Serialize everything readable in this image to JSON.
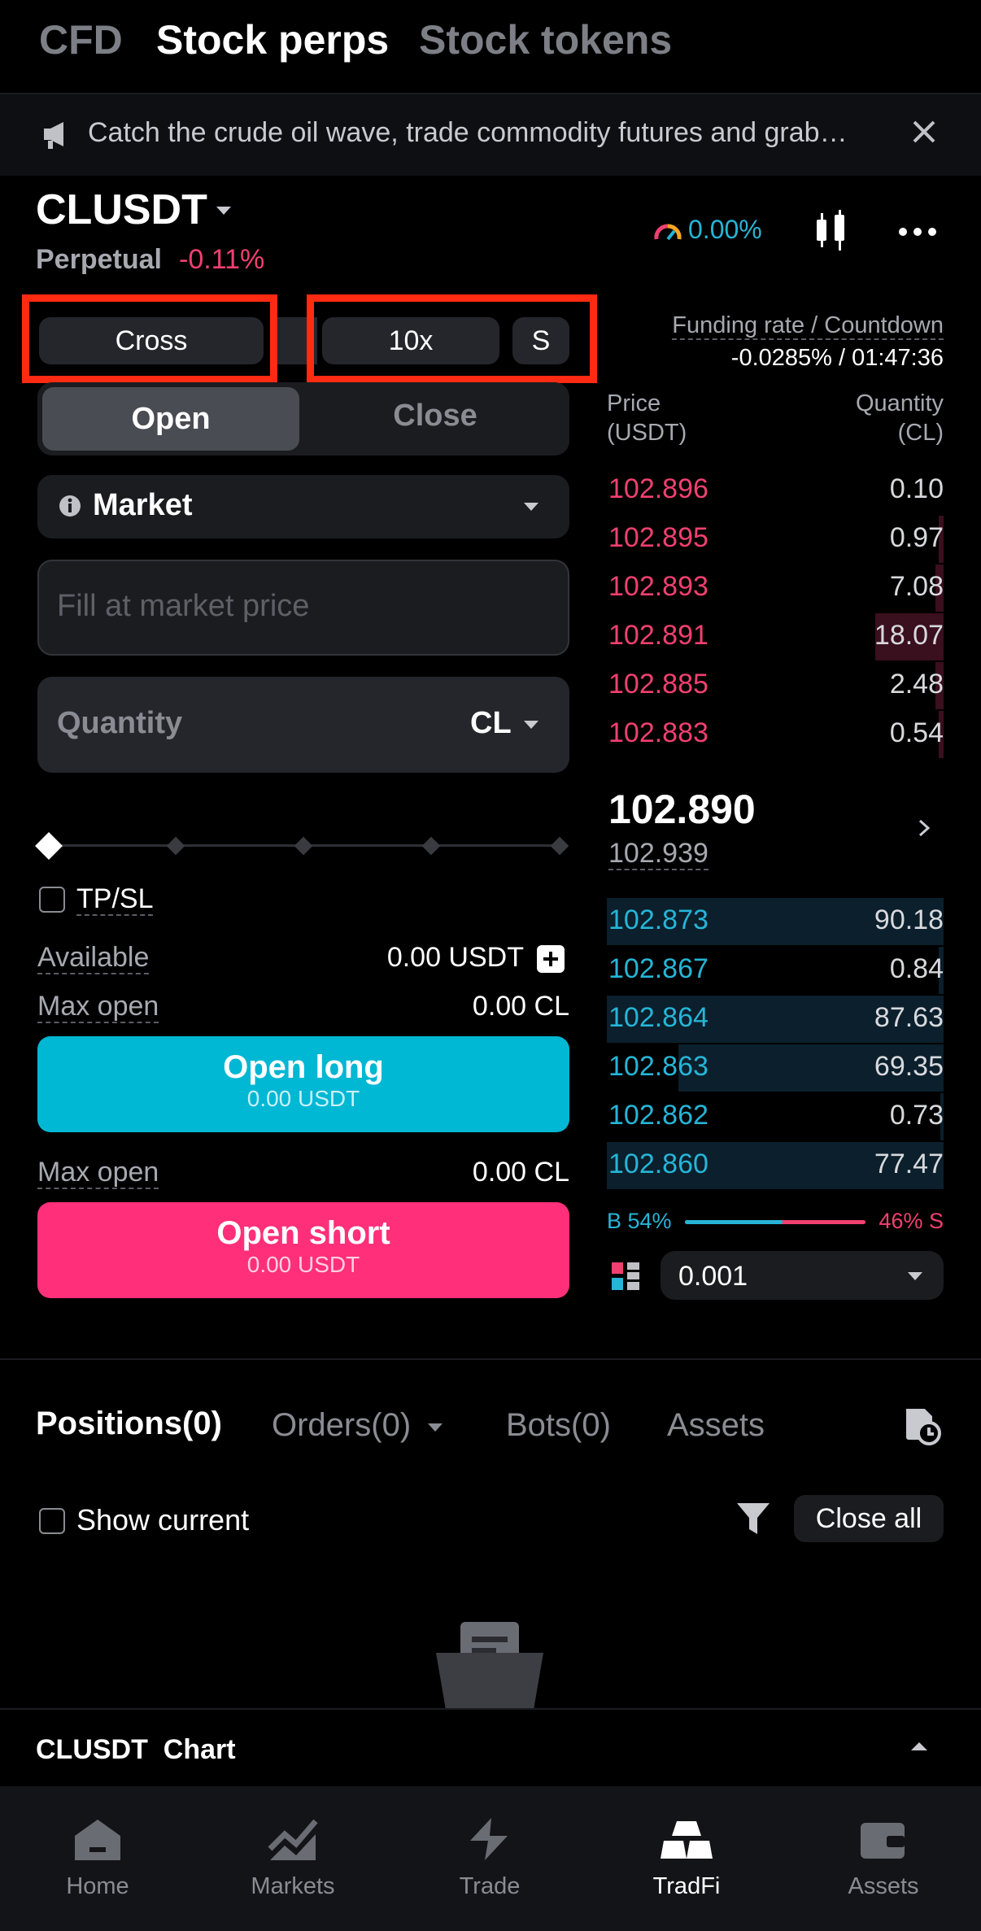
{
  "top_tabs": {
    "cfd": "CFD",
    "stock_perps": "Stock perps",
    "stock_tokens": "Stock tokens"
  },
  "banner": {
    "text": "Catch the crude oil wave, trade commodity futures and grab…"
  },
  "symbol": {
    "name": "CLUSDT",
    "type": "Perpetual",
    "change": "-0.11%",
    "gauge_pct": "0.00%"
  },
  "margin": {
    "mode": "Cross",
    "leverage": "10x",
    "side_badge": "S"
  },
  "funding": {
    "label": "Funding rate / Countdown",
    "value": "-0.0285% / 01:47:36"
  },
  "trade_tabs": {
    "open": "Open",
    "close": "Close"
  },
  "order_type": {
    "label": "Market"
  },
  "price_field": {
    "placeholder": "Fill at market price"
  },
  "quantity_field": {
    "label": "Quantity",
    "unit": "CL"
  },
  "slider": {
    "value_pct": 0
  },
  "tpsl": {
    "label": "TP/SL"
  },
  "available": {
    "label": "Available",
    "value": "0.00 USDT"
  },
  "long": {
    "max_label": "Max open",
    "max_value": "0.00 CL",
    "button": "Open long",
    "sub": "0.00 USDT"
  },
  "short": {
    "max_label": "Max open",
    "max_value": "0.00 CL",
    "button": "Open short",
    "sub": "0.00 USDT"
  },
  "orderbook": {
    "price_header": "Price",
    "price_unit": "(USDT)",
    "qty_header": "Quantity",
    "qty_unit": "(CL)",
    "asks": [
      {
        "price": "102.896",
        "qty": "0.10"
      },
      {
        "price": "102.895",
        "qty": "0.97"
      },
      {
        "price": "102.893",
        "qty": "7.08"
      },
      {
        "price": "102.891",
        "qty": "18.07"
      },
      {
        "price": "102.885",
        "qty": "2.48"
      },
      {
        "price": "102.883",
        "qty": "0.54"
      }
    ],
    "last_price": "102.890",
    "mark_price": "102.939",
    "bids": [
      {
        "price": "102.873",
        "qty": "90.18"
      },
      {
        "price": "102.867",
        "qty": "0.84"
      },
      {
        "price": "102.864",
        "qty": "87.63"
      },
      {
        "price": "102.863",
        "qty": "69.35"
      },
      {
        "price": "102.862",
        "qty": "0.73"
      },
      {
        "price": "102.860",
        "qty": "77.47"
      }
    ],
    "buy_ratio": "B 54%",
    "sell_ratio": "46% S",
    "buy_ratio_value": 54,
    "precision": "0.001"
  },
  "positions_tabs": {
    "positions": "Positions(0)",
    "orders": "Orders(0)",
    "bots": "Bots(0)",
    "assets": "Assets"
  },
  "show_current": {
    "label": "Show current"
  },
  "close_all": {
    "label": "Close all"
  },
  "chart_bar": {
    "label": "CLUSDT  Chart"
  },
  "bottom_nav": {
    "home": "Home",
    "markets": "Markets",
    "trade": "Trade",
    "tradfi": "TradFi",
    "assets": "Assets"
  },
  "colors": {
    "ask": "#f0406f",
    "bid": "#26b5d6",
    "long": "#00b7d4",
    "short": "#ff2f79",
    "highlight": "#ff2a12"
  }
}
